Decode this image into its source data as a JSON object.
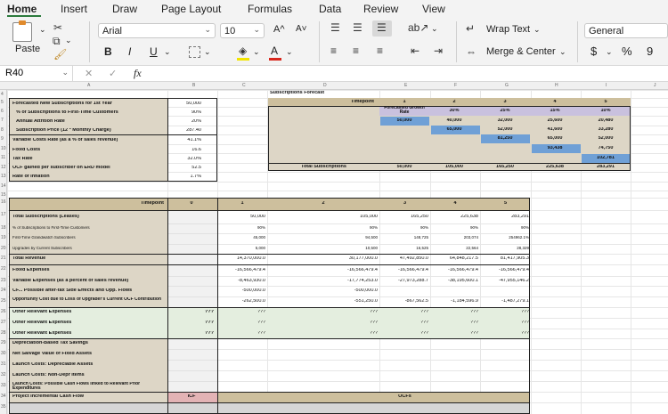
{
  "ribbon": {
    "tabs": [
      "Home",
      "Insert",
      "Draw",
      "Page Layout",
      "Formulas",
      "Data",
      "Review",
      "View"
    ],
    "paste_label": "Paste",
    "font_name": "Arial",
    "font_size": "10",
    "bold": "B",
    "italic": "I",
    "underline": "U",
    "wrap_text": "Wrap Text",
    "merge_center": "Merge & Center",
    "number_format": "General",
    "currency": "$",
    "percent": "%",
    "comma": "9",
    "font_grow": "A^",
    "font_shrink": "A˅",
    "font_color": "A"
  },
  "formula_bar": {
    "name_box": "R40",
    "fx": "fx"
  },
  "grid": {
    "columns": [
      "A",
      "B",
      "C",
      "D",
      "E",
      "F",
      "G",
      "H",
      "I",
      "J"
    ],
    "rows": [
      "4",
      "5",
      "6",
      "7",
      "8",
      "9",
      "10",
      "11",
      "12",
      "13",
      "14",
      "15",
      "16",
      "17",
      "18",
      "19",
      "20",
      "21",
      "22",
      "23",
      "24",
      "25",
      "26",
      "27",
      "28",
      "29",
      "30",
      "31",
      "32",
      "33",
      "34",
      "35"
    ]
  },
  "params": {
    "forecast_label": "Forecasted New Subscriptions for 1st Year",
    "forecast_value": "50,000",
    "pct_first_time_label": "% of Subscriptions to First-Time Customers",
    "pct_first_time_value": "90%",
    "attrition_label": "Annual Attrition Rate",
    "attrition_value": "20%",
    "price_label": "Subscription Price (12 * Monthly Charge)",
    "price_value": "287.40",
    "var_cost_label": "Variable Costs Rate (as a % of sales revenue)",
    "var_cost_value": "41.1%",
    "fixed_label": "Fixed Costs",
    "fixed_value": "16.6",
    "tax_label": "Tax Rate",
    "tax_value": "32.0%",
    "ocf_label": "OCF gained per subscriber on ERD model",
    "ocf_value": "52.5",
    "inflation_label": "Rate of Inflation",
    "inflation_value": "1.7%"
  },
  "forecast": {
    "title": "Subscriptions Forecast",
    "timepoint_label": "Timepoint",
    "years": [
      "1",
      "2",
      "3",
      "4",
      "5"
    ],
    "growth_label": "Forecasted Growth Rate",
    "growth_rates": [
      "30%",
      "25%",
      "15%",
      "10%"
    ],
    "cohort_rows": [
      [
        "50,000",
        "40,000",
        "32,000",
        "25,600",
        "20,480"
      ],
      [
        "",
        "65,000",
        "52,000",
        "41,600",
        "33,280"
      ],
      [
        "",
        "",
        "81,250",
        "65,000",
        "52,000"
      ],
      [
        "",
        "",
        "",
        "93,438",
        "74,750"
      ],
      [
        "",
        "",
        "",
        "",
        "102,781"
      ]
    ],
    "total_label": "Total Subscriptions",
    "totals": [
      "50,000",
      "105,000",
      "165,250",
      "225,638",
      "283,291"
    ]
  },
  "cashflow": {
    "timepoint_label": "Timepoint",
    "timepoints": [
      "0",
      "1",
      "2",
      "3",
      "4",
      "5"
    ],
    "rows": [
      {
        "label": "Total Subscriptions (Leases)",
        "values": [
          "",
          "50,000",
          "105,000",
          "165,250",
          "225,638",
          "283,291"
        ]
      },
      {
        "label": "% of Subscriptions to First-Time Customers",
        "values": [
          "",
          "90%",
          "90%",
          "90%",
          "90%",
          "90%"
        ]
      },
      {
        "label": "First-Time Grandwatch Subscribers",
        "values": [
          "",
          "45,000",
          "94,500",
          "148,725",
          "203,074",
          "254962.1%"
        ]
      },
      {
        "label": "Upgrades by Current Subscribers",
        "values": [
          "",
          "5,000",
          "10,500",
          "16,525",
          "22,564",
          "28,329"
        ]
      },
      {
        "label": "Total Revenue",
        "values": [
          "",
          "14,370,000.0",
          "30,177,000.0",
          "47,492,850.0",
          "64,848,217.5",
          "81,417,905.3"
        ]
      },
      {
        "label": "Fixed Expenses",
        "values": [
          "",
          "-16,566,479.4",
          "-16,566,479.4",
          "-16,566,479.4",
          "-16,566,479.4",
          "-16,566,479.4"
        ]
      },
      {
        "label": "Variable Expenses (as a percent of sales revenue)",
        "values": [
          "",
          "-8,463,930.0",
          "-17,774,253.0",
          "-27,973,288.7",
          "-38,195,600.1",
          "-47,955,146.2"
        ]
      },
      {
        "label": "CF... Possible after-tax Side Effects and Opp. Flows",
        "values": [
          "",
          "-500,000.0",
          "-500,000.0",
          "",
          "",
          ""
        ]
      },
      {
        "label": "Opportunity Cost due to Loss of Upgrader's Current OCF Contribution",
        "values": [
          "",
          "-262,500.0",
          "-551,250.0",
          "-867,562.5",
          "-1,184,596.9",
          "-1,487,279.1"
        ]
      },
      {
        "label": "Other Relevant Expenses",
        "values": [
          "???",
          "???",
          "???",
          "???",
          "???",
          "???"
        ]
      },
      {
        "label": "Other Relevant Expenses",
        "values": [
          "???",
          "???",
          "???",
          "???",
          "???",
          "???"
        ]
      },
      {
        "label": "Other Relevant Expenses",
        "values": [
          "???",
          "???",
          "???",
          "???",
          "???",
          "???"
        ]
      },
      {
        "label": "Depreciation-Based Tax Savings",
        "values": [
          "",
          "",
          "",
          "",
          "",
          ""
        ]
      },
      {
        "label": "Net Salvage Value of Fixed Assets",
        "values": [
          "",
          "",
          "",
          "",
          "",
          ""
        ]
      },
      {
        "label": "Launch Costs: Depreciable Assets",
        "values": [
          "",
          "",
          "",
          "",
          "",
          ""
        ]
      },
      {
        "label": "Launch Costs: Non-Depr Items",
        "values": [
          "",
          "",
          "",
          "",
          "",
          ""
        ]
      },
      {
        "label": "Launch Costs: Possible Cash Flows linked to Relevant Prior Expenditures",
        "values": [
          "",
          "",
          "",
          "",
          "",
          ""
        ]
      },
      {
        "label": "Project Incremental Cash Flow",
        "values": [
          "ICF",
          "",
          "",
          "OCFs",
          "",
          ""
        ]
      }
    ]
  }
}
